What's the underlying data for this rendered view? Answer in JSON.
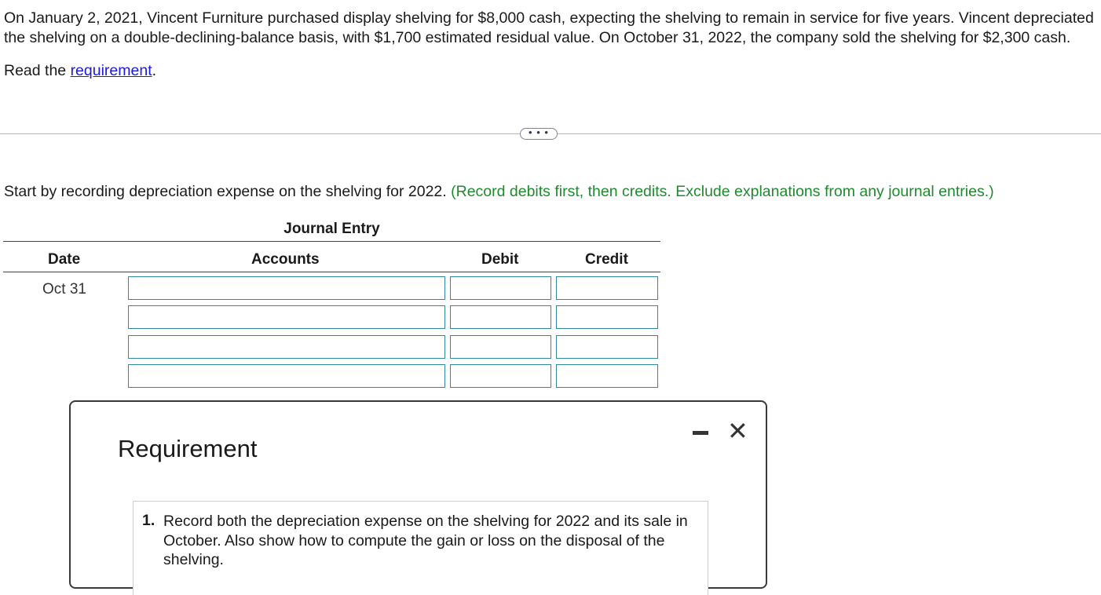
{
  "problem": {
    "intro": "On January 2, 2021, Vincent Furniture purchased display shelving for $8,000 cash, expecting the shelving to remain in service for five years. Vincent depreciated the shelving on a double-declining-balance basis, with $1,700 estimated residual value. On October 31, 2022, the company sold the shelving for $2,300 cash.",
    "read_prefix": "Read the ",
    "read_link": "requirement",
    "read_suffix": "."
  },
  "more_button": "• • •",
  "instruction": {
    "main": "Start by recording depreciation expense on the shelving for 2022.",
    "note": "(Record debits first, then credits. Exclude explanations from any journal entries.)"
  },
  "journal": {
    "title": "Journal Entry",
    "headers": {
      "date": "Date",
      "accounts": "Accounts",
      "debit": "Debit",
      "credit": "Credit"
    },
    "date_value": "Oct 31",
    "rows": [
      {
        "account": "",
        "debit": "",
        "credit": ""
      },
      {
        "account": "",
        "debit": "",
        "credit": ""
      },
      {
        "account": "",
        "debit": "",
        "credit": ""
      },
      {
        "account": "",
        "debit": "",
        "credit": ""
      }
    ]
  },
  "modal": {
    "title": "Requirement",
    "item_number": "1.",
    "item_text": "Record both the depreciation expense on the shelving for 2022 and its sale in October. Also show how to compute the gain or loss on the disposal of the shelving."
  },
  "icons": {
    "minimize": "minimize-icon",
    "close": "close-icon"
  }
}
